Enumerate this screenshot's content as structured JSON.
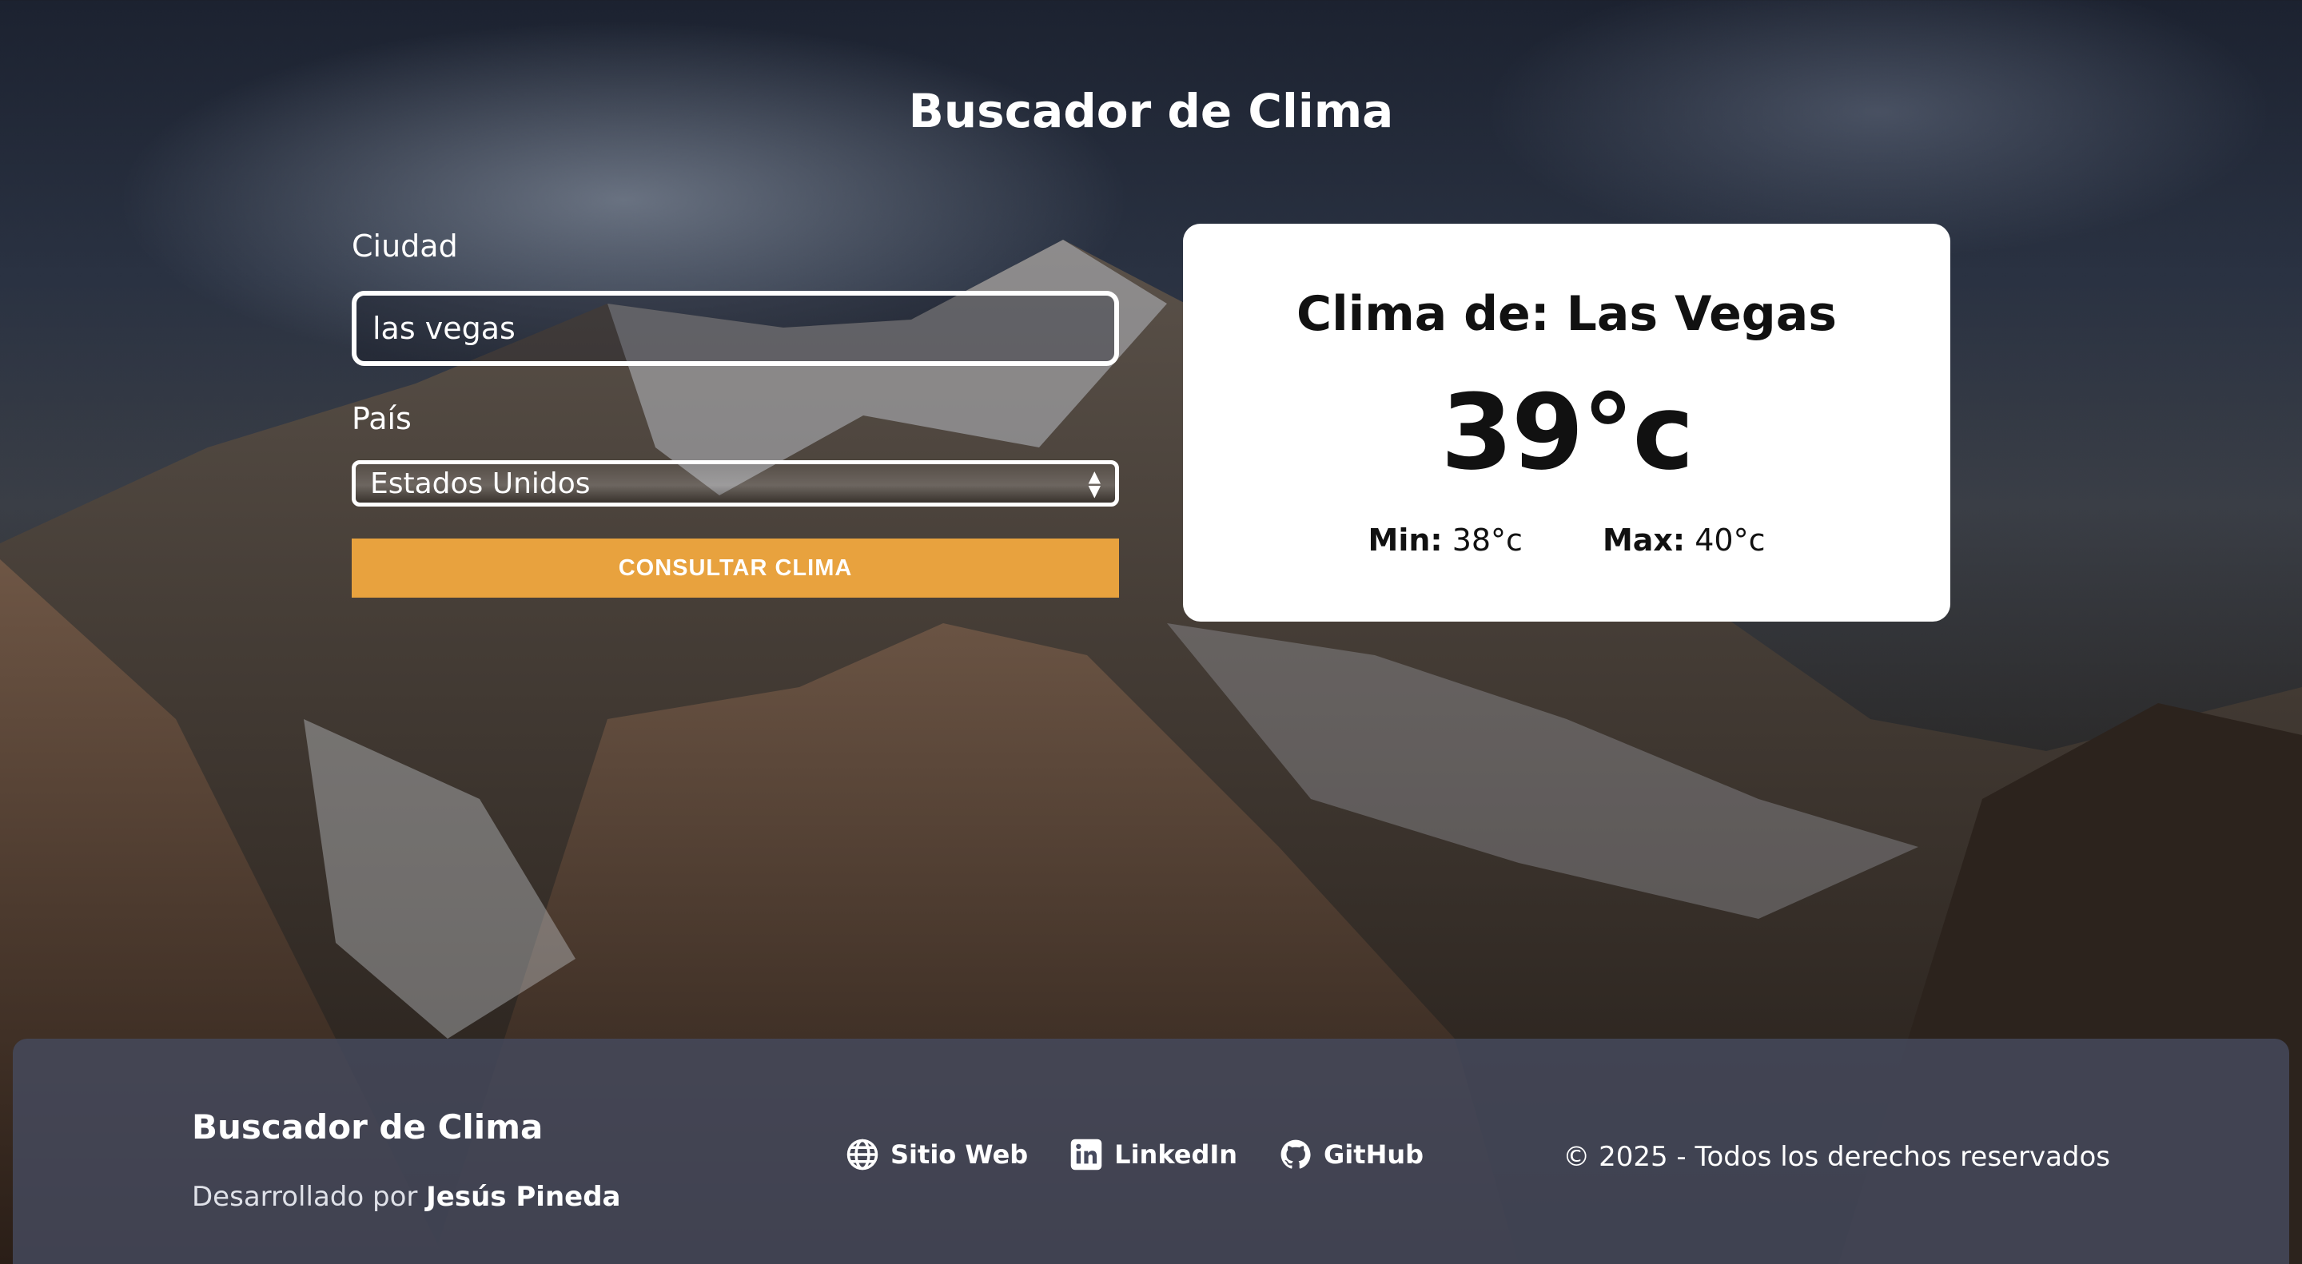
{
  "page": {
    "title": "Buscador de Clima"
  },
  "form": {
    "city_label": "Ciudad",
    "city_value": "las vegas",
    "country_label": "País",
    "country_selected": "Estados Unidos",
    "submit_label": "CONSULTAR CLIMA",
    "accent_color": "#e8a23e"
  },
  "weather": {
    "title": "Clima de: Las Vegas",
    "temperature": "39°c",
    "min_label": "Min:",
    "min_value": "38°c",
    "max_label": "Max:",
    "max_value": "40°c"
  },
  "footer": {
    "brand": "Buscador de Clima",
    "credit_prefix": "Desarrollado por",
    "credit_author": "Jesús Pineda",
    "links": [
      {
        "label": "Sitio Web",
        "icon": "globe-icon"
      },
      {
        "label": "LinkedIn",
        "icon": "linkedin-icon"
      },
      {
        "label": "GitHub",
        "icon": "github-icon"
      }
    ],
    "copyright": "© 2025 - Todos los derechos reservados"
  }
}
